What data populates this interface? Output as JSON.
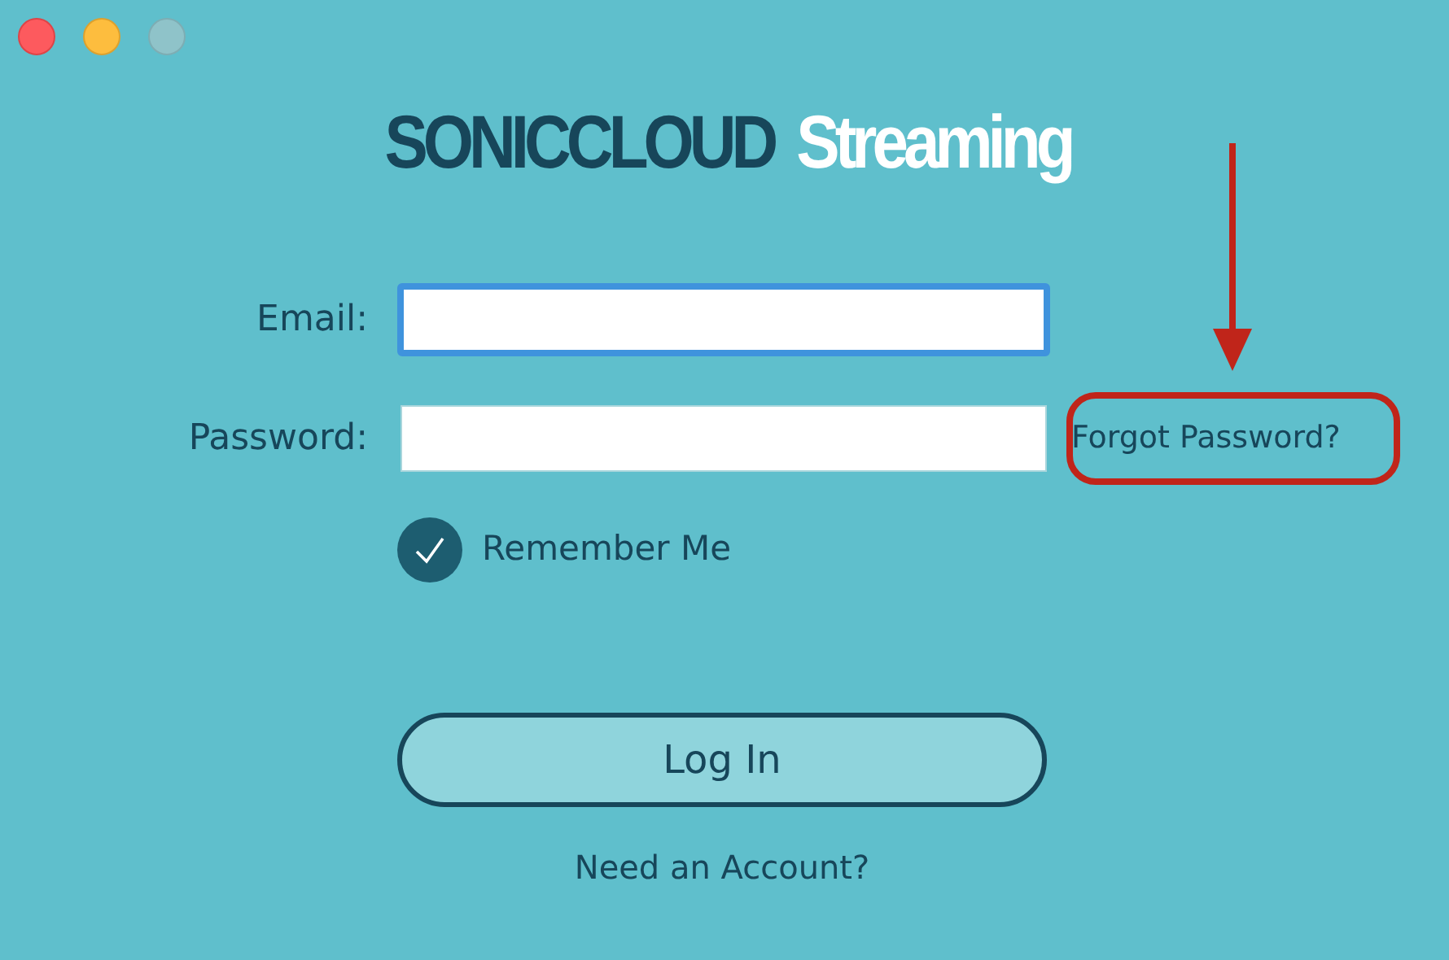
{
  "logo": {
    "brand": "SONICCLOUD",
    "product": "Streaming"
  },
  "fields": [
    {
      "label": "Email:",
      "focused": true
    },
    {
      "label": "Password:",
      "focused": false
    }
  ],
  "forgot_link": "Forgot Password?",
  "remember": {
    "label": "Remember Me",
    "checked": true
  },
  "login_button": "Log In",
  "signup_link": "Need an Account?"
}
